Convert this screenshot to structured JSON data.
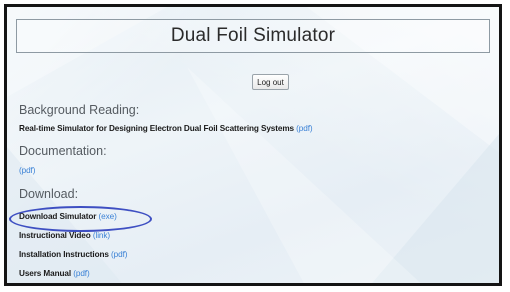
{
  "app": {
    "title": "Dual Foil Simulator",
    "logout_label": "Log out"
  },
  "sections": {
    "background": {
      "heading": "Background Reading:",
      "items": [
        {
          "text": "Real-time Simulator for Designing Electron Dual Foil Scattering Systems",
          "link": "(pdf)"
        }
      ]
    },
    "documentation": {
      "heading": "Documentation:",
      "items": [
        {
          "text": "",
          "link": "(pdf)"
        }
      ]
    },
    "download": {
      "heading": "Download:",
      "items": [
        {
          "text": "Download Simulator",
          "link": "(exe)"
        },
        {
          "text": "Instructional Video",
          "link": "(link)"
        },
        {
          "text": "Installation Instructions",
          "link": "(pdf)"
        },
        {
          "text": "Users Manual",
          "link": "(pdf)"
        }
      ]
    }
  },
  "colors": {
    "link": "#3b82d6",
    "highlight_circle": "#3e4fc2",
    "frame_border": "#141414"
  }
}
